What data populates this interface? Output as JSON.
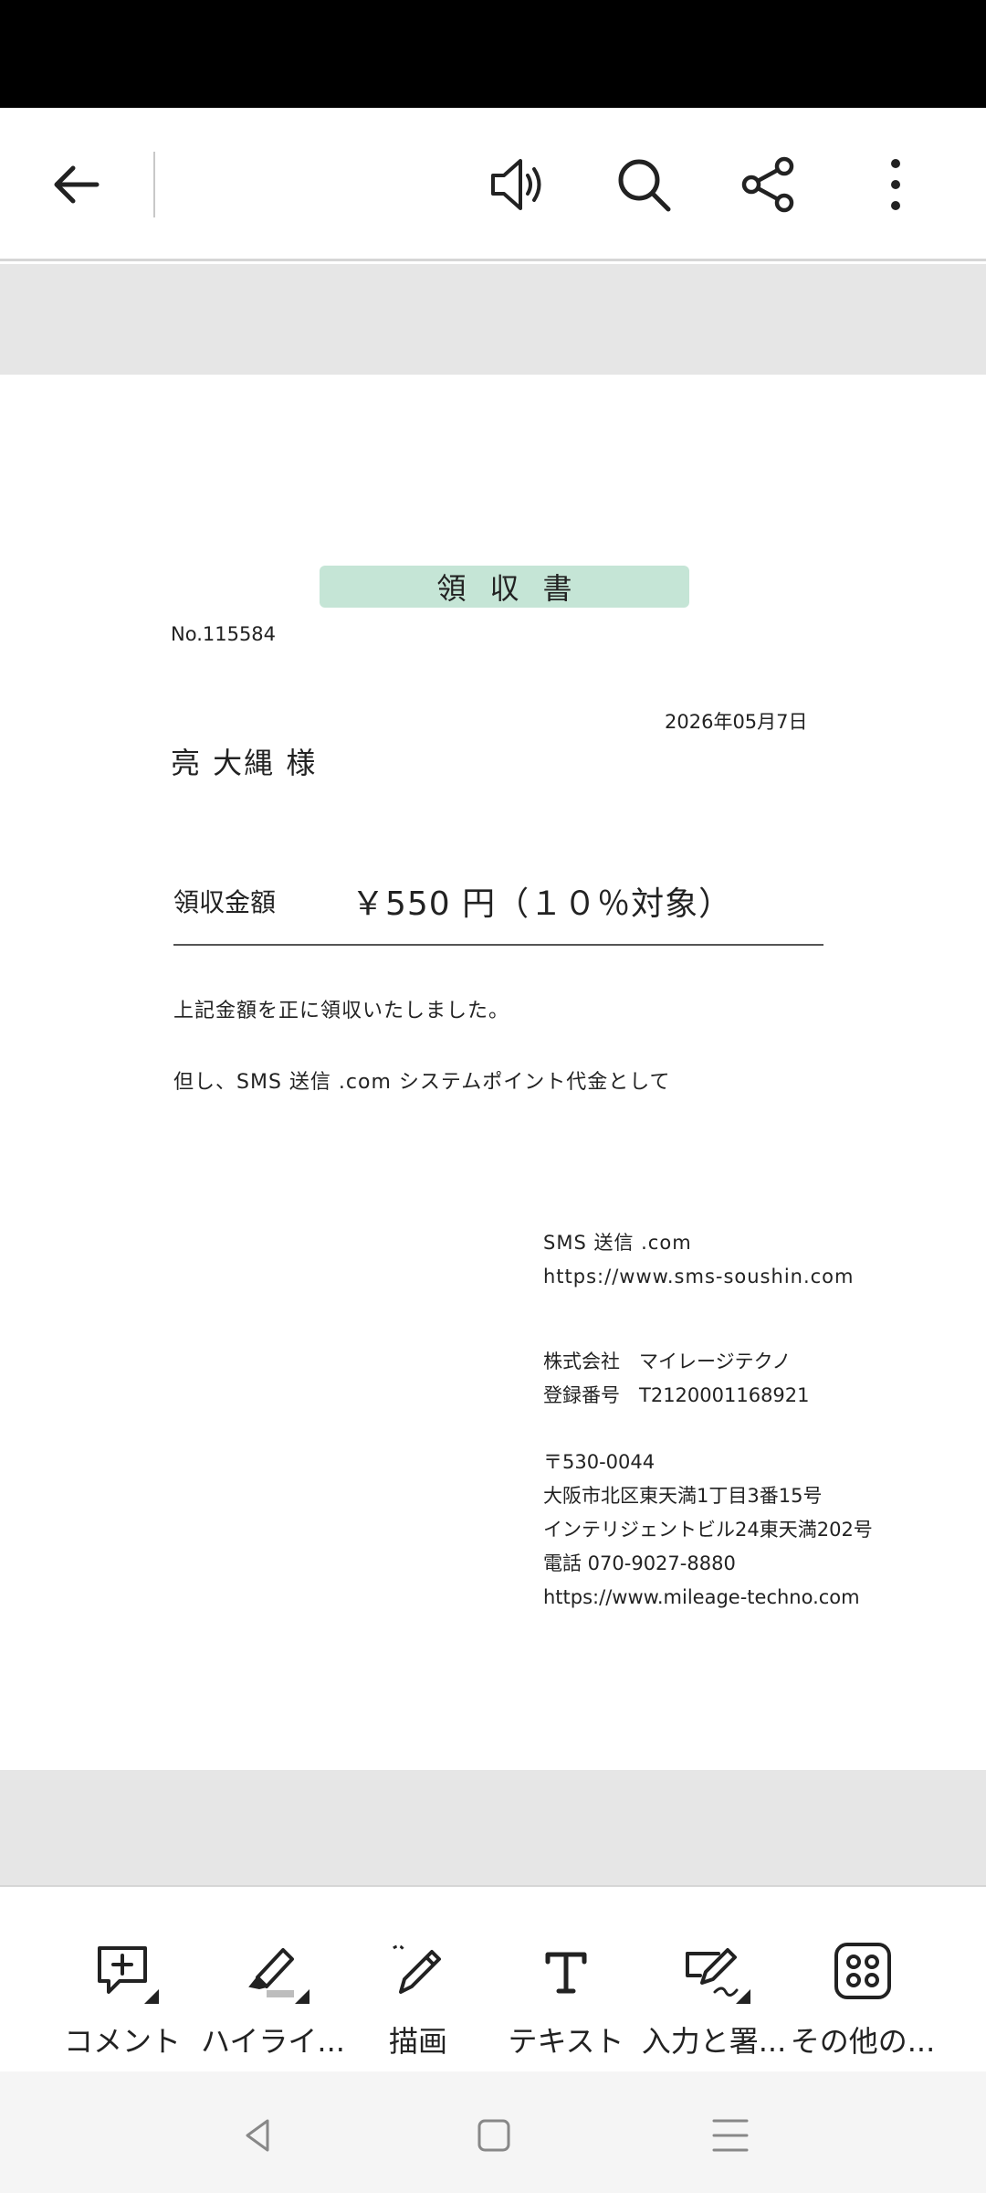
{
  "toolbar": {
    "back_icon": "arrow-left-icon",
    "read_aloud_icon": "speaker-icon",
    "search_icon": "search-icon",
    "share_icon": "share-icon",
    "more_icon": "more-vertical-icon"
  },
  "document": {
    "title": "領収書",
    "number": "No.115584",
    "date": "2026年05月7日",
    "recipient": "亮 大縄  様",
    "amount_label": "領収金額",
    "amount_value": "￥550 円（１０％対象）",
    "note_received": "上記金額を正に領収いたしました。",
    "note_purpose": "但し、SMS 送信 .com システムポイント代金として",
    "issuer": {
      "service_name": "SMS 送信 .com",
      "service_url": "https://www.sms-soushin.com",
      "company": "株式会社　マイレージテクノ",
      "registration": "登録番号　T2120001168921",
      "postal": "〒530-0044",
      "address1": "大阪市北区東天満1丁目3番15号",
      "address2": "インテリジェントビル24東天満202号",
      "phone": "電話  070-9027-8880",
      "company_url": "https://www.mileage-techno.com"
    }
  },
  "bottom_tools": [
    {
      "label": "コメント",
      "icon": "comment-add-icon"
    },
    {
      "label": "ハイライ...",
      "icon": "highlighter-icon"
    },
    {
      "label": "描画",
      "icon": "pen-draw-icon"
    },
    {
      "label": "テキスト",
      "icon": "text-icon"
    },
    {
      "label": "入力と署...",
      "icon": "fill-sign-icon"
    },
    {
      "label": "その他の...",
      "icon": "grid-more-icon"
    }
  ],
  "colors": {
    "title_highlight": "#c5e5d6",
    "gray_margin": "#e6e6e6",
    "status_bar": "#000000"
  }
}
